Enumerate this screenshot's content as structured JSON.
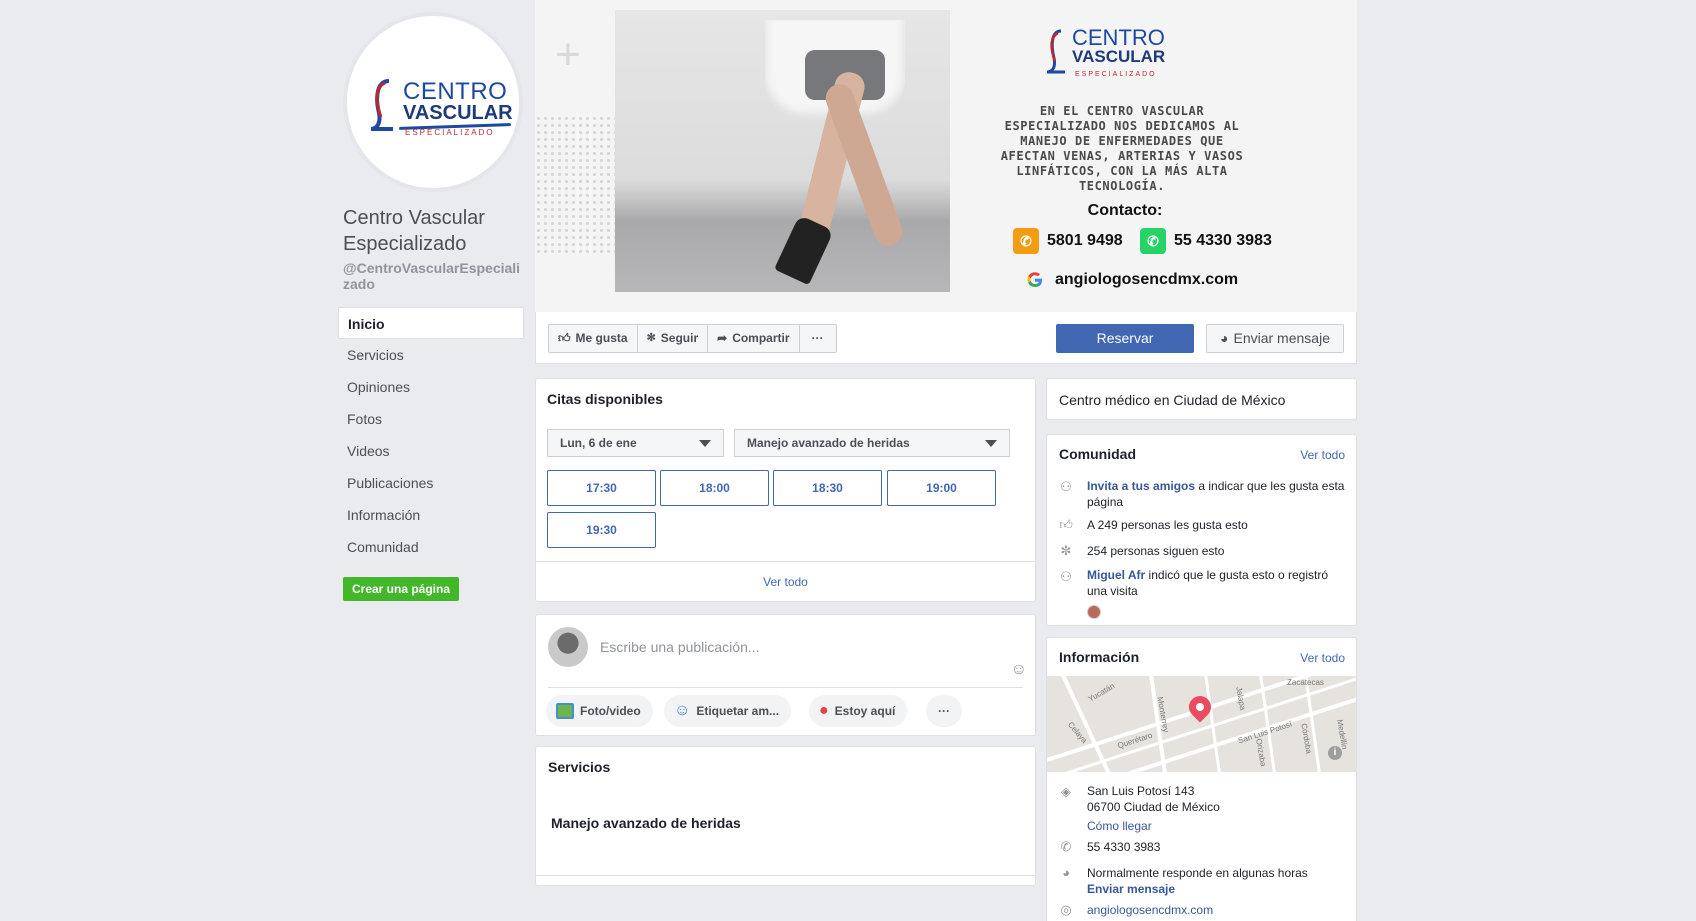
{
  "page": {
    "name": "Centro Vascular Especializado",
    "handle": "@CentroVascularEspecializado",
    "logo": {
      "line1": "CENTRO",
      "line2": "VASCULAR",
      "line3": "ESPECIALIZADO"
    }
  },
  "nav": {
    "items": [
      "Inicio",
      "Servicios",
      "Opiniones",
      "Fotos",
      "Videos",
      "Publicaciones",
      "Información",
      "Comunidad"
    ],
    "create_page": "Crear una página"
  },
  "cover": {
    "description": "EN EL CENTRO VASCULAR ESPECIALIZADO NOS DEDICAMOS AL MANEJO DE ENFERMEDADES QUE AFECTAN VENAS, ARTERIAS Y VASOS LINFÁTICOS, CON LA MÁS ALTA TECNOLOGÍA.",
    "contact_label": "Contacto:",
    "phone": "5801 9498",
    "whatsapp": "55 4330 3983",
    "website": "angiologosencdmx.com"
  },
  "actions": {
    "like": "Me gusta",
    "follow": "Seguir",
    "share": "Compartir",
    "more": "···",
    "book": "Reservar",
    "message": "Enviar mensaje"
  },
  "citas": {
    "title": "Citas disponibles",
    "date": "Lun, 6 de ene",
    "service": "Manejo avanzado de heridas",
    "slots": [
      "17:30",
      "18:00",
      "18:30",
      "19:00",
      "19:30"
    ],
    "see_all": "Ver todo"
  },
  "composer": {
    "placeholder": "Escribe una publicación...",
    "photo": "Foto/video",
    "tag": "Etiquetar am...",
    "checkin": "Estoy aquí",
    "more": "···"
  },
  "servicios": {
    "title": "Servicios",
    "item": "Manejo avanzado de heridas"
  },
  "category": "Centro médico en Ciudad de México",
  "comunidad": {
    "title": "Comunidad",
    "see_all": "Ver todo",
    "invite_link": "Invita a tus amigos",
    "invite_rest": " a indicar que les gusta esta página",
    "likes": "A 249 personas les gusta esto",
    "follows": "254 personas siguen esto",
    "visitor_name": "Miguel Afr",
    "visitor_rest": " indicó que le gusta esto o registró una visita"
  },
  "informacion": {
    "title": "Información",
    "see_all": "Ver todo",
    "address1": "San Luis Potosí 143",
    "address2": "06700 Ciudad de México",
    "directions": "Cómo llegar",
    "phone": "55 4330 3983",
    "response": "Normalmente responde en algunas horas",
    "send_message": "Enviar mensaje",
    "website": "angiologosencdmx.com",
    "map_labels": [
      "Yucatán",
      "Zacatecas",
      "Jalapa",
      "Monterrey",
      "Querétaro",
      "San Luis Potosí",
      "Celaya",
      "Orizaba",
      "Córdoba",
      "Medellín"
    ]
  },
  "colors": {
    "facebook_blue": "#4267b2",
    "green": "#42b72a",
    "background": "#e9ebee"
  }
}
